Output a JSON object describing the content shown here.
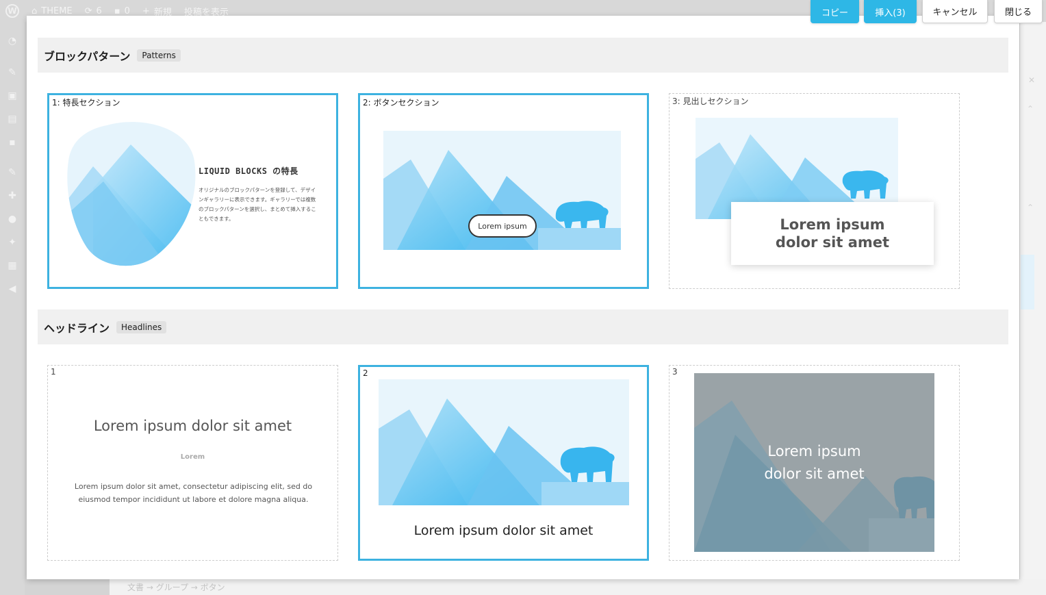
{
  "adminbar": {
    "site_name": "THEME",
    "updates": "6",
    "comments": "0",
    "new_label": "新規",
    "view_post": "投稿を表示"
  },
  "toolbar": {
    "copy_label": "コピー",
    "insert_label": "挿入(3)",
    "cancel_label": "キャンセル",
    "close_label": "閉じる"
  },
  "sections": [
    {
      "title": "ブロックパターン",
      "tag": "Patterns",
      "cards": [
        {
          "label": "1: 特長セクション",
          "selected": true,
          "heading": "LIQUID BLOCKS の特長",
          "body": "オリジナルのブロックパターンを登録して、デザインギャラリーに表示できます。ギャラリーでは複数のブロックパターンを選択し、まとめて挿入することもできます。"
        },
        {
          "label": "2: ボタンセクション",
          "selected": true,
          "button": "Lorem ipsum"
        },
        {
          "label": "3: 見出しセクション",
          "selected": false,
          "heading": "Lorem ipsum dolor sit amet"
        }
      ]
    },
    {
      "title": "ヘッドライン",
      "tag": "Headlines",
      "cards": [
        {
          "label": "1",
          "selected": false,
          "title": "Lorem ipsum dolor sit amet",
          "sub": "Lorem",
          "body": "Lorem ipsum dolor sit amet, consectetur adipiscing elit, sed do eiusmod tempor incididunt ut labore et dolore magna aliqua."
        },
        {
          "label": "2",
          "selected": true,
          "title": "Lorem ipsum dolor sit amet"
        },
        {
          "label": "3",
          "selected": false,
          "line1": "Lorem ipsum",
          "line2": "dolor sit amet"
        }
      ]
    }
  ],
  "breadcrumb": "文書 → グループ → ボタン",
  "colors": {
    "accent": "#2eb7e6",
    "selected_border": "#3db2e0",
    "section_bg": "#f0f0f0"
  }
}
